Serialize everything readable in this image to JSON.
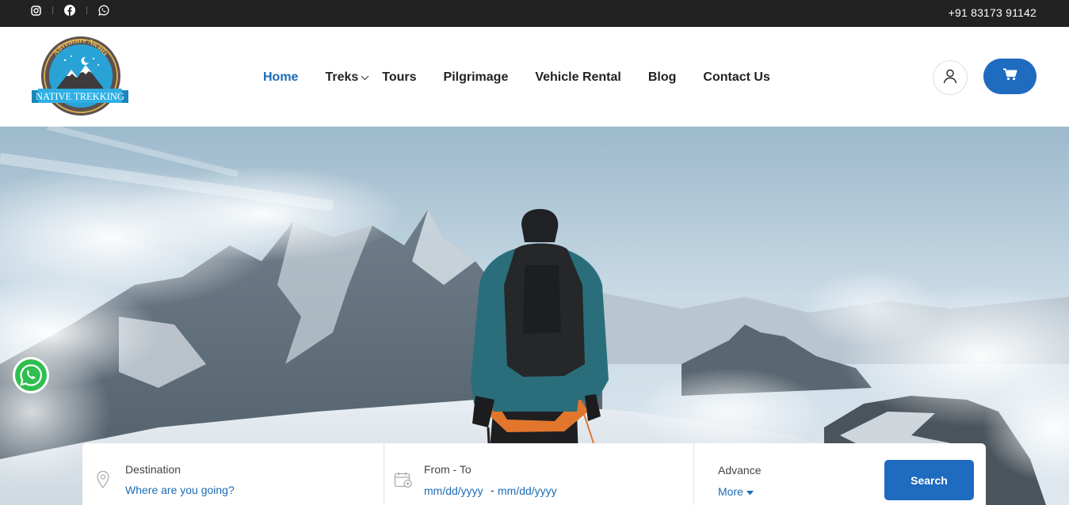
{
  "topbar": {
    "phone": "+91 83173 91142",
    "social_icons": [
      "instagram-icon",
      "facebook-icon",
      "whatsapp-icon"
    ],
    "background": "#222222"
  },
  "logo": {
    "arc_text": "Adventure Awaits",
    "banner_text": "NATIVE TREKKING"
  },
  "nav": {
    "items": [
      {
        "label": "Home",
        "active": true
      },
      {
        "label": "Treks",
        "has_dropdown": true
      },
      {
        "label": "Tours"
      },
      {
        "label": "Pilgrimage"
      },
      {
        "label": "Vehicle Rental"
      },
      {
        "label": "Blog"
      },
      {
        "label": "Contact Us"
      }
    ],
    "accent": "#1d6bb5"
  },
  "actions": {
    "user_icon": "user-icon",
    "cart_icon": "cart-icon",
    "cart_color": "#1e6bbf"
  },
  "hero": {
    "floating_icon": "whatsapp-icon"
  },
  "search": {
    "destination_label": "Destination",
    "destination_placeholder": "Where are you going?",
    "dates_label": "From - To",
    "from_placeholder": "mm/dd/yyyy",
    "dates_separator": "-",
    "to_placeholder": "mm/dd/yyyy",
    "advance_label": "Advance",
    "more_label": "More",
    "button_label": "Search"
  }
}
